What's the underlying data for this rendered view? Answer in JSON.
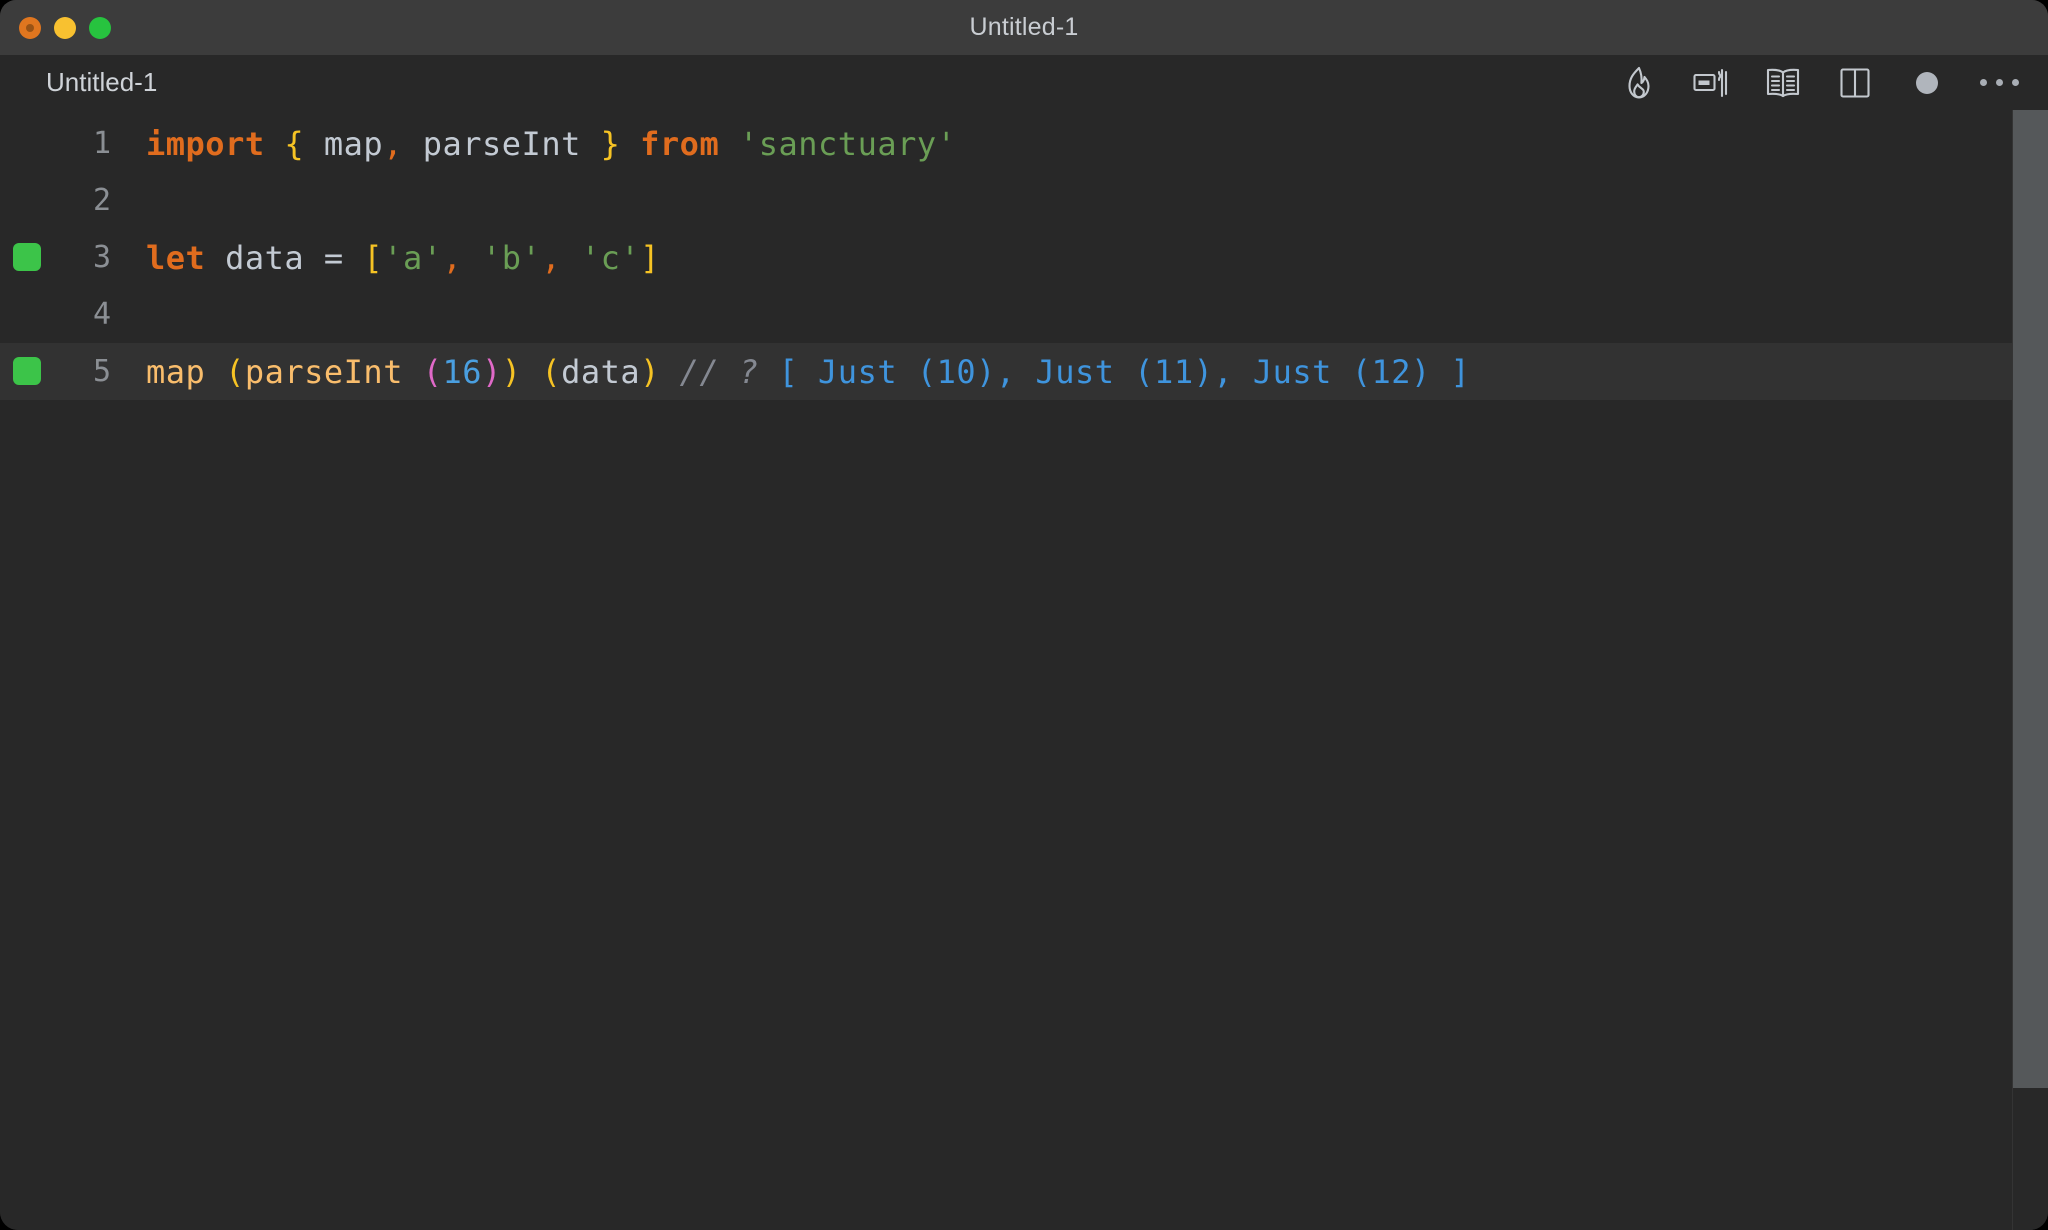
{
  "window": {
    "title": "Untitled-1",
    "traffic_lights": [
      {
        "name": "close",
        "color": "#e0761f"
      },
      {
        "name": "minimize",
        "color": "#f8c130"
      },
      {
        "name": "maximize",
        "color": "#27c33f"
      }
    ]
  },
  "tab": {
    "label": "Untitled-1"
  },
  "toolbar": {
    "items": [
      {
        "icon": "flame-icon",
        "label": "Flame"
      },
      {
        "icon": "run-code-icon",
        "label": "Run Code"
      },
      {
        "icon": "open-book-icon",
        "label": "Open Preview"
      },
      {
        "icon": "split-editor-icon",
        "label": "Split Editor"
      },
      {
        "icon": "unsaved-dot-icon",
        "label": "Unsaved Changes"
      },
      {
        "icon": "more-actions-icon",
        "label": "More Actions"
      }
    ]
  },
  "editor": {
    "active_line": 5,
    "breakpoint_lines": [
      3,
      5
    ],
    "lines": [
      {
        "number": "1",
        "marker": false,
        "active": false,
        "tokens": [
          {
            "text": "import",
            "type": "kw"
          },
          {
            "text": " ",
            "type": "plain"
          },
          {
            "text": "{",
            "type": "brace"
          },
          {
            "text": " map",
            "type": "plain"
          },
          {
            "text": ",",
            "type": "punct-o"
          },
          {
            "text": " parseInt ",
            "type": "plain"
          },
          {
            "text": "}",
            "type": "brace"
          },
          {
            "text": " ",
            "type": "plain"
          },
          {
            "text": "from",
            "type": "kw"
          },
          {
            "text": " ",
            "type": "plain"
          },
          {
            "text": "'sanctuary'",
            "type": "string"
          }
        ]
      },
      {
        "number": "2",
        "marker": false,
        "active": false,
        "tokens": []
      },
      {
        "number": "3",
        "marker": true,
        "active": false,
        "tokens": [
          {
            "text": "let",
            "type": "kw"
          },
          {
            "text": " data ",
            "type": "plain"
          },
          {
            "text": "=",
            "type": "plain"
          },
          {
            "text": " ",
            "type": "plain"
          },
          {
            "text": "[",
            "type": "brace"
          },
          {
            "text": "'a'",
            "type": "string"
          },
          {
            "text": ",",
            "type": "punct-o"
          },
          {
            "text": " ",
            "type": "plain"
          },
          {
            "text": "'b'",
            "type": "string"
          },
          {
            "text": ",",
            "type": "punct-o"
          },
          {
            "text": " ",
            "type": "plain"
          },
          {
            "text": "'c'",
            "type": "string"
          },
          {
            "text": "]",
            "type": "brace"
          }
        ]
      },
      {
        "number": "4",
        "marker": false,
        "active": false,
        "tokens": []
      },
      {
        "number": "5",
        "marker": true,
        "active": true,
        "tokens": [
          {
            "text": "map ",
            "type": "fn"
          },
          {
            "text": "(",
            "type": "paren-y"
          },
          {
            "text": "parseInt ",
            "type": "fn"
          },
          {
            "text": "(",
            "type": "paren-m"
          },
          {
            "text": "16",
            "type": "num"
          },
          {
            "text": ")",
            "type": "paren-m"
          },
          {
            "text": ")",
            "type": "paren-y"
          },
          {
            "text": " ",
            "type": "plain"
          },
          {
            "text": "(",
            "type": "paren-y"
          },
          {
            "text": "data",
            "type": "plain"
          },
          {
            "text": ")",
            "type": "paren-y"
          },
          {
            "text": " ",
            "type": "plain"
          },
          {
            "text": "// ?",
            "type": "comment"
          },
          {
            "text": " ",
            "type": "plain"
          },
          {
            "text": "[ Just (10), Just (11), Just (12) ]",
            "type": "out"
          }
        ]
      }
    ]
  },
  "colors": {
    "window_bg": "#282828",
    "titlebar_bg": "#3c3c3c",
    "active_line_bg": "#323232",
    "breakpoint_green": "#3cc449",
    "keyword_orange": "#e06c1e",
    "brace_yellow": "#f6c324",
    "string_green": "#6a9e55",
    "function_tan": "#f9bd6c",
    "paren_magenta": "#e069c8",
    "number_blue": "#4a9fe0",
    "output_blue": "#3f94dd",
    "comment_gray": "#848891",
    "plain_text": "#c3cad3",
    "scrollbar_gray": "#55585a"
  }
}
